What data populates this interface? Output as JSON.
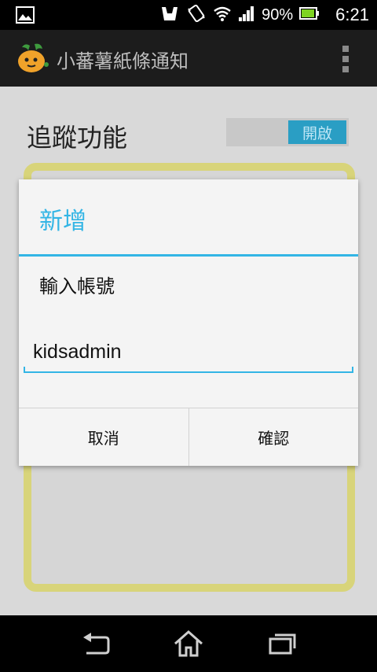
{
  "status_bar": {
    "battery_percent": "90%",
    "time": "6:21",
    "icons": [
      "image-notification-icon",
      "bag-icon",
      "vibrate-icon",
      "wifi-icon",
      "signal-icon",
      "battery-icon"
    ]
  },
  "action_bar": {
    "title": "小蕃薯紙條通知",
    "icons": [
      "app-logo-icon",
      "overflow-menu-icon"
    ]
  },
  "content": {
    "tracking_label": "追蹤功能",
    "toggle_state": "開啟"
  },
  "dialog": {
    "title": "新增",
    "message": "輸入帳號",
    "input_value": "kidsadmin",
    "cancel_label": "取消",
    "confirm_label": "確認"
  },
  "colors": {
    "accent": "#33b5e5",
    "panel_border": "#d8d47a",
    "toggle_on": "#2a9ec4"
  },
  "nav_bar": {
    "icons": [
      "back-icon",
      "home-icon",
      "recent-apps-icon"
    ]
  }
}
